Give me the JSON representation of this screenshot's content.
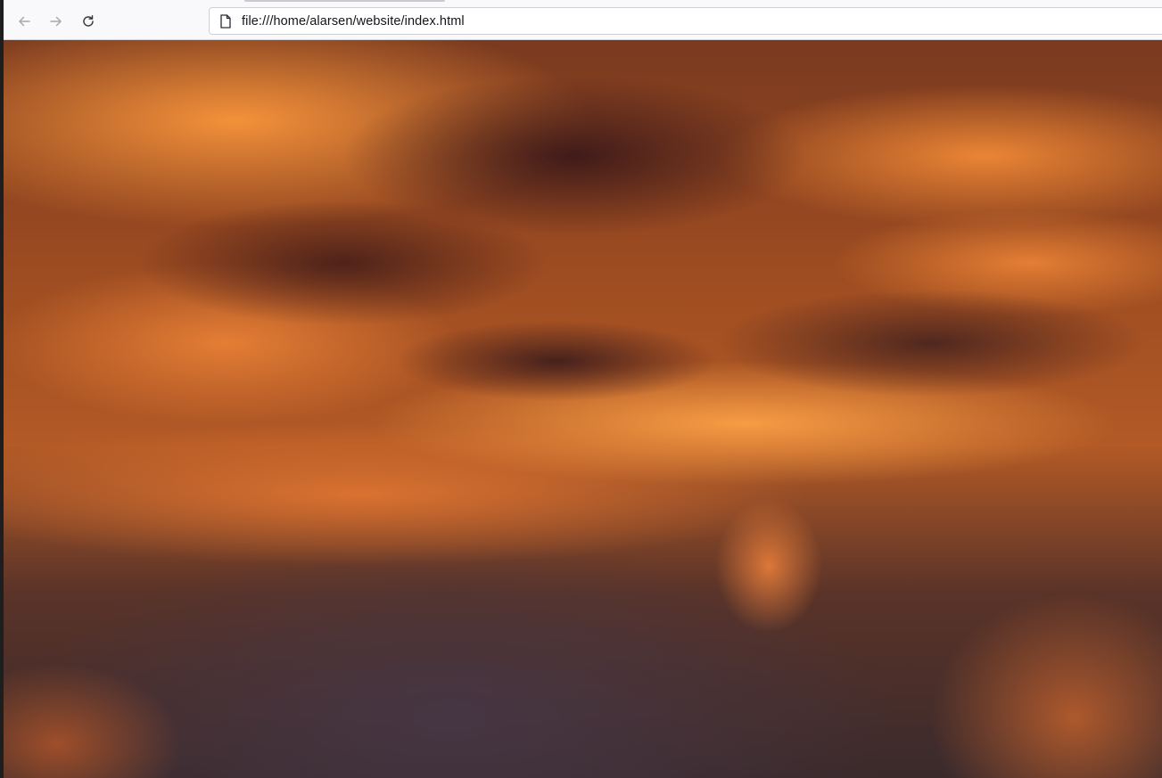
{
  "browser": {
    "url": "file:///home/alarsen/website/index.html",
    "nav": {
      "back_icon": "arrow-left-icon",
      "forward_icon": "arrow-right-icon",
      "reload_icon": "reload-icon",
      "page_icon": "document-icon"
    }
  },
  "page": {
    "background_image": "sunset-clouds",
    "colors": {
      "cloud_highlight": "#f29a45",
      "cloud_shadow": "#3c2224",
      "toolbar_bg": "#f9f9fb"
    }
  }
}
